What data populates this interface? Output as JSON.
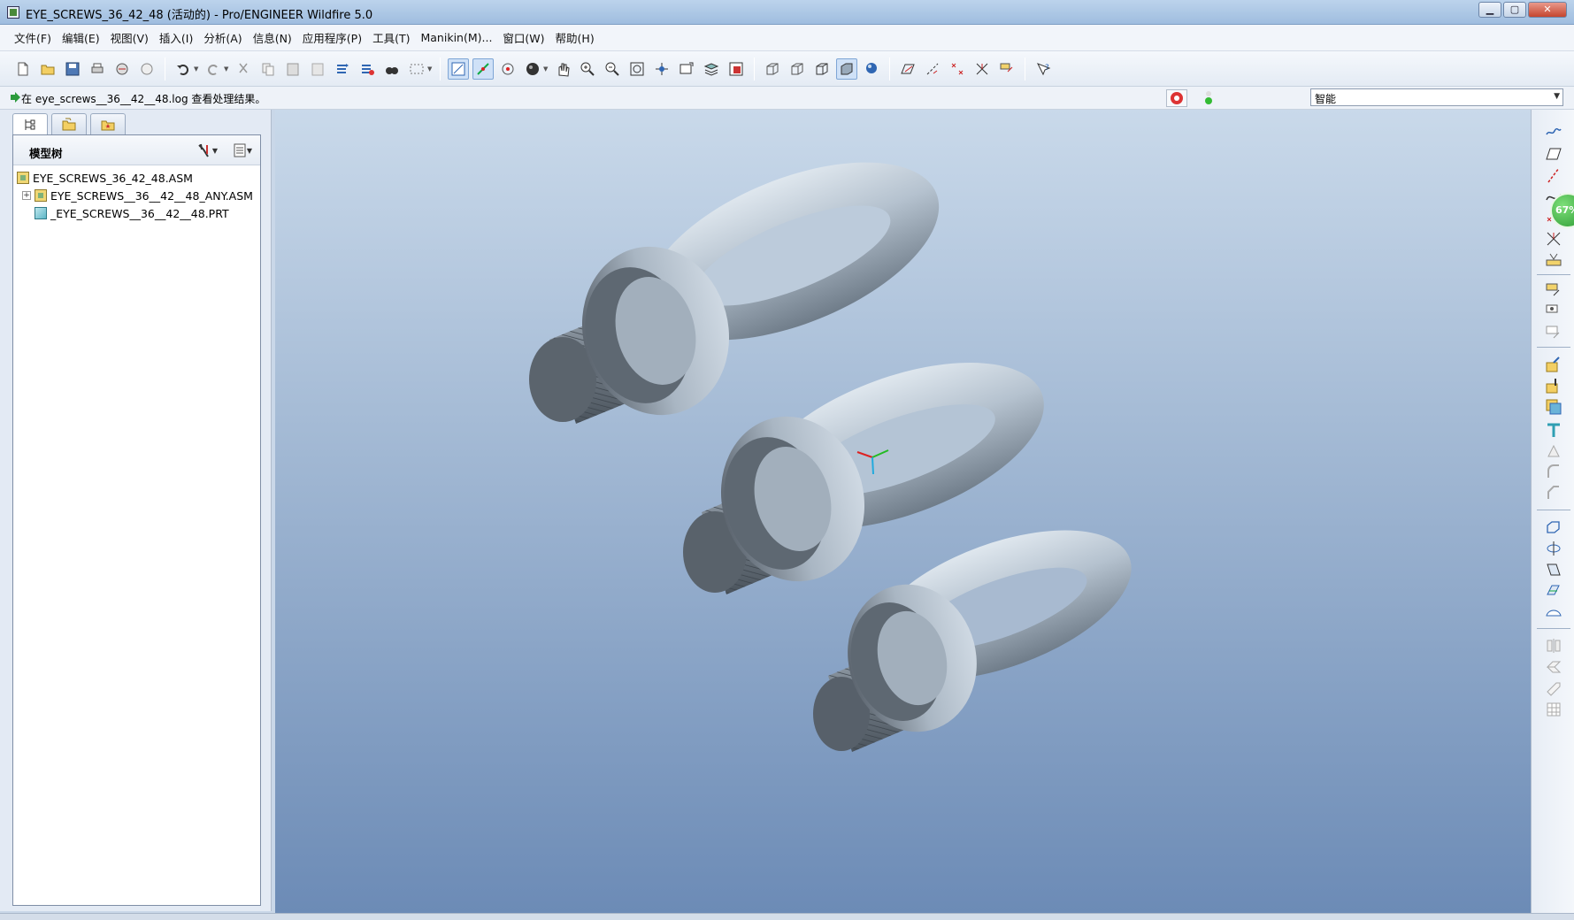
{
  "window": {
    "title": "EYE_SCREWS_36_42_48 (活动的) - Pro/ENGINEER Wildfire 5.0",
    "controls": [
      "minimize",
      "maximize",
      "close"
    ]
  },
  "menu": [
    "文件(F)",
    "编辑(E)",
    "视图(V)",
    "插入(I)",
    "分析(A)",
    "信息(N)",
    "应用程序(P)",
    "工具(T)",
    "Manikin(M)...",
    "窗口(W)",
    "帮助(H)"
  ],
  "message": {
    "text": "在 eye_screws__36__42__48.log 查看处理结果。"
  },
  "filter": {
    "value": "智能"
  },
  "model_tree": {
    "title": "模型树",
    "items": [
      {
        "label": "EYE_SCREWS_36_42_48.ASM",
        "type": "asm"
      },
      {
        "label": "EYE_SCREWS__36__42__48_ANY.ASM",
        "type": "asm"
      },
      {
        "label": "_EYE_SCREWS__36__42__48.PRT",
        "type": "prt"
      }
    ]
  },
  "zoom_badge": "67%",
  "colors": {
    "viewport_top": "#c9d9ea",
    "viewport_bottom": "#6c8bb6",
    "part_body": "#a9b8c6",
    "part_shadow": "#4c5660"
  }
}
